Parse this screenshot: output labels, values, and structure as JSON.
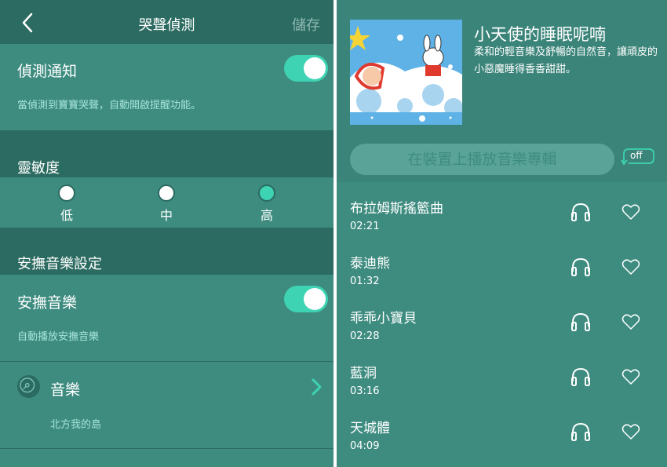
{
  "left": {
    "nav": {
      "title": "哭聲偵測",
      "save_label": "儲存"
    },
    "detect": {
      "label": "偵測通知",
      "hint": "當偵測到寶寶哭聲，自動開啟提醒功能。",
      "enabled": true
    },
    "sensitivity": {
      "header": "靈敏度",
      "options": [
        {
          "label": "低",
          "selected": false
        },
        {
          "label": "中",
          "selected": false
        },
        {
          "label": "高",
          "selected": true
        }
      ]
    },
    "soothing_settings": {
      "header": "安撫音樂設定"
    },
    "soothing": {
      "label": "安撫音樂",
      "hint": "自動播放安撫音樂",
      "enabled": true
    },
    "music": {
      "label": "音樂",
      "value": "北方我的島"
    }
  },
  "right": {
    "album": {
      "title": "小天使的睡眠呢喃",
      "description": "柔和的輕音樂及舒暢的自然音，讓頑皮的小惡魔睡得香香甜甜。"
    },
    "play_button_label": "在裝置上播放音樂專輯",
    "toggle_label": "off",
    "tracks": [
      {
        "title": "布拉姆斯搖籃曲",
        "duration": "02:21"
      },
      {
        "title": "泰迪熊",
        "duration": "01:32"
      },
      {
        "title": "乖乖小寶貝",
        "duration": "02:28"
      },
      {
        "title": "藍洞",
        "duration": "03:16"
      },
      {
        "title": "天城體",
        "duration": "04:09"
      }
    ]
  },
  "colors": {
    "teal_bg": "#3e8c80",
    "teal_dark": "#2b6b61",
    "accent": "#3ed3b3",
    "hint_text": "#a6e3d8"
  }
}
